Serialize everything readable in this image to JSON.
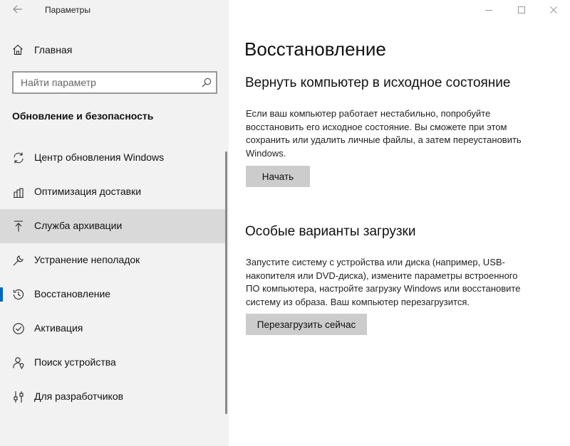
{
  "window": {
    "title": "Параметры",
    "back_icon": "back-arrow-icon",
    "controls": [
      "minimize-icon",
      "maximize-icon",
      "close-icon"
    ]
  },
  "sidebar": {
    "home": {
      "label": "Главная",
      "icon": "home-icon"
    },
    "search": {
      "placeholder": "Найти параметр",
      "value": "",
      "icon": "search-icon"
    },
    "section_title": "Обновление и безопасность",
    "items": [
      {
        "label": "Центр обновления Windows",
        "icon": "sync-icon",
        "state": "normal"
      },
      {
        "label": "Оптимизация доставки",
        "icon": "delivery-icon",
        "state": "normal"
      },
      {
        "label": "Служба архивации",
        "icon": "upload-icon",
        "state": "hover"
      },
      {
        "label": "Устранение неполадок",
        "icon": "wrench-icon",
        "state": "normal"
      },
      {
        "label": "Восстановление",
        "icon": "history-icon",
        "state": "selected"
      },
      {
        "label": "Активация",
        "icon": "check-circle-icon",
        "state": "normal"
      },
      {
        "label": "Поиск устройства",
        "icon": "person-location-icon",
        "state": "normal"
      },
      {
        "label": "Для разработчиков",
        "icon": "sliders-icon",
        "state": "normal"
      }
    ]
  },
  "main": {
    "title": "Восстановление",
    "reset": {
      "heading": "Вернуть компьютер в исходное состояние",
      "lines": [
        "Если ваш компьютер работает нестабильно, попробуйте",
        "восстановить его исходное состояние. Вы сможете при этом",
        "сохранить или удалить личные файлы, а затем переустановить",
        "Windows."
      ],
      "button": "Начать"
    },
    "advanced": {
      "heading": "Особые варианты загрузки",
      "lines": [
        "Запустите систему с устройства или диска (например, USB-",
        "накопителя или DVD-диска), измените параметры встроенного",
        "ПО компьютера, настройте загрузку Windows или восстановите",
        "систему из образа. Ваш компьютер перезагрузится."
      ],
      "button": "Перезагрузить сейчас"
    }
  },
  "colors": {
    "sidebar_bg": "#f2f2f2",
    "hover_bg": "#d9d9d9",
    "accent": "#0067c0",
    "button_bg": "#cccccc"
  }
}
